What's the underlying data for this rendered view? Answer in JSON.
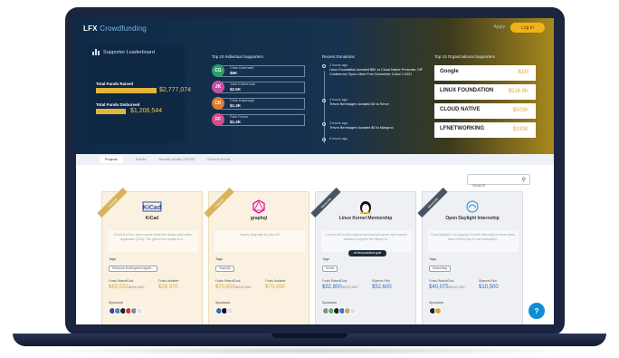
{
  "header": {
    "logo_prefix": "LFX",
    "logo_suffix": "Crowdfunding",
    "apply_label": "Apply",
    "login_label": "Log In"
  },
  "leaderboard": {
    "title": "Supporter Leaderboard",
    "raised_label": "Total Funds Raised",
    "raised_value": "$2,777,074",
    "raised_fill": 0.9,
    "disbursed_label": "Total Funds Disbursed",
    "disbursed_value": "$1,206,544",
    "disbursed_fill": 0.45
  },
  "supporters": {
    "title": "Top 10 Individual Supporters",
    "items": [
      {
        "initials": "CG",
        "name": "Chris Guernsell",
        "amount": "$5K",
        "color": "#2e9e6e"
      },
      {
        "initials": "JK",
        "name": "John Kreherman",
        "amount": "$2.5K",
        "color": "#c84fa4"
      },
      {
        "initials": "CK",
        "name": "Chris Kassnagh",
        "amount": "$1.3K",
        "color": "#e07b2f"
      },
      {
        "initials": "FF",
        "name": "Fidel Flores",
        "amount": "$1.3K",
        "color": "#d44d87"
      }
    ]
  },
  "donations": {
    "title": "Recent Donations",
    "items": [
      {
        "ago": "2 hours ago",
        "text": "Linux Foundation donated $5K to Cloud Native Presents: OIF Conference Open Lifers Free December 3 And 4 2021"
      },
      {
        "ago": "4 hours ago",
        "text": "Trevor Bernhagen donated $0 to Serve"
      },
      {
        "ago": "4 hours ago",
        "text": "Trevor Bernhagen donated $0 to Mangroo"
      },
      {
        "ago": "6 hours ago",
        "text": ""
      }
    ]
  },
  "organizations": {
    "title": "Top 10 Organizational Supporters",
    "items": [
      {
        "name": "Google",
        "amount": "$1M"
      },
      {
        "name": "LINUX FOUNDATION",
        "amount": "$516.6K"
      },
      {
        "name": "CLOUD NATIVE",
        "amount": "$503K"
      },
      {
        "name": "LFNETWORKING",
        "amount": "$193K"
      }
    ]
  },
  "tabs": [
    "Projects",
    "Events",
    "Security Audits (OSTIF)",
    "General Funds"
  ],
  "search": {
    "placeholder": "Search"
  },
  "cards": [
    {
      "ribbon": "Featured",
      "logo": "KiCad",
      "name": "KiCad",
      "theme": "#faf1e1",
      "ribbon_color": "#d9b35c",
      "desc": "KiCad is a free, open source electronic design automation application (EDA). The goal of the project is to...",
      "tags_label": "Tags",
      "tag": "Electronic Development Applic...",
      "raised_label": "Funds Raised/Goal",
      "raised": "$83,532",
      "goal": "/$100,000",
      "avail_label": "Funds Available",
      "avail": "$28,970",
      "value_color": "#d9a53a",
      "sponsors_label": "Sponsors",
      "avatars": [
        "#3a4a8a",
        "#5b7fb8",
        "#222222",
        "#c43b3b",
        "#8a8a8a",
        "#e2e2e2"
      ]
    },
    {
      "ribbon": "Featured",
      "logo": "graphql",
      "name": "graphql",
      "theme": "#faf1e1",
      "ribbon_color": "#d9b35c",
      "desc": "A query language for your API",
      "tags_label": "Tags",
      "tag": "GraphQL",
      "raised_label": "Funds Raised/Goal",
      "raised": "$70,659",
      "goal": "/$100,000",
      "avail_label": "Funds Available",
      "avail": "$70,000",
      "value_color": "#d9a53a",
      "sponsors_label": "Sponsors",
      "avatars": [
        "#2e6ea8",
        "#111111",
        "#e0e0e0"
      ]
    },
    {
      "ribbon": "Mentorship",
      "logo": "linux",
      "name": "Linux Kernel Mentorship",
      "theme": "#eef0f4",
      "ribbon_color": "#4a5563",
      "desc": "Linux is the world's largest and most pervasive open source software project in the history of...",
      "tags_label": "Tags",
      "tag": "Kernel",
      "best": "cli best practices gold",
      "raised_label": "Funds Raised/Goal",
      "raised": "$52,800",
      "goal": "/$100,000",
      "avail_label": "Stipends Paid",
      "avail": "$52,600",
      "value_color": "#2b6cc4",
      "sponsors_label": "Sponsors",
      "avatars": [
        "#8a8a8a",
        "#5bb07a",
        "#222222",
        "#3a7cc4",
        "#c9a56b",
        "#e0e0e0"
      ]
    },
    {
      "ribbon": "Mentorship",
      "logo": "opendaylight",
      "name": "Open Daylight Internship",
      "theme": "#eef0f4",
      "ribbon_color": "#4a5563",
      "desc": "OpenDaylight is an ongoing 3 month internship for three dices, ideal of fixed only to real subsystem...",
      "tags_label": "Tags",
      "tag": "Networking",
      "raised_label": "Funds Raised/Goal",
      "raised": "$40,075",
      "goal": "/$100,000",
      "avail_label": "Stipends Paid",
      "avail": "$10,500",
      "value_color": "#2b6cc4",
      "sponsors_label": "Sponsors",
      "avatars": [
        "#222222",
        "#e0a030"
      ]
    }
  ],
  "help": {
    "label": "?"
  }
}
